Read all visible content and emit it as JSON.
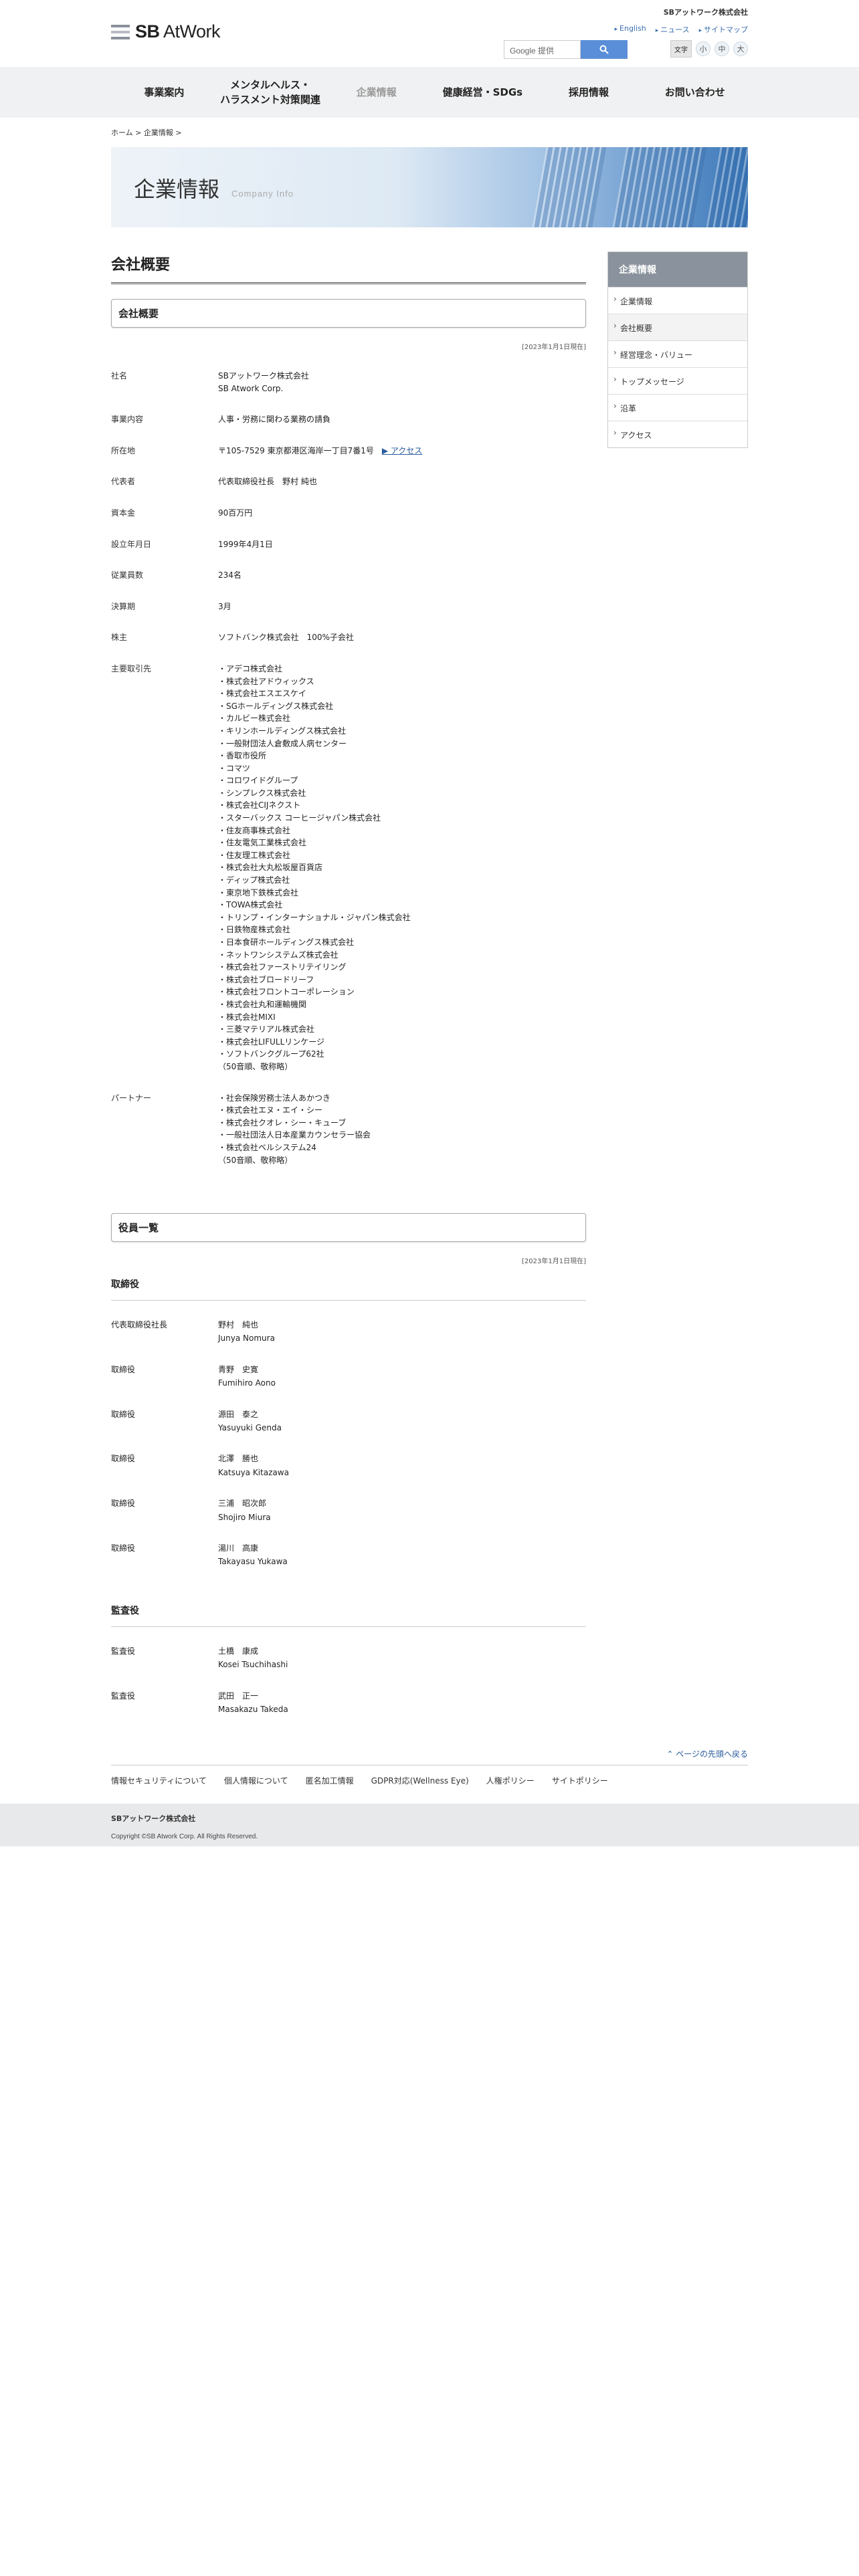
{
  "header": {
    "logo_text_prefix": "SB",
    "logo_text_main": "AtWork",
    "company_name": "SBアットワーク株式会社",
    "links": [
      "English",
      "ニュース",
      "サイトマップ"
    ],
    "search_placeholder": "Google 提供",
    "font_size_label": "文字",
    "font_sizes": [
      "小",
      "中",
      "大"
    ]
  },
  "nav": [
    {
      "line1": "事業案内",
      "line2": ""
    },
    {
      "line1": "メンタルヘルス・",
      "line2": "ハラスメント対策関連"
    },
    {
      "line1": "企業情報",
      "line2": ""
    },
    {
      "line1": "健康経営・SDGs",
      "line2": ""
    },
    {
      "line1": "採用情報",
      "line2": ""
    },
    {
      "line1": "お問い合わせ",
      "line2": ""
    }
  ],
  "breadcrumb": {
    "home": "ホーム",
    "current": "企業情報"
  },
  "hero": {
    "title": "企業情報",
    "subtitle": "Company Info"
  },
  "page_title": "会社概要",
  "overview": {
    "heading": "会社概要",
    "date": "[2023年1月1日現在]",
    "rows": [
      {
        "label": "社名",
        "lines": [
          "SBアットワーク株式会社",
          "SB Atwork Corp."
        ]
      },
      {
        "label": "事業内容",
        "lines": [
          "人事・労務に関わる業務の請負"
        ]
      },
      {
        "label": "所在地",
        "lines": [
          "〒105-7529 東京都港区海岸一丁目7番1号"
        ],
        "link": "▶ アクセス"
      },
      {
        "label": "代表者",
        "lines": [
          "代表取締役社長　野村 純也"
        ]
      },
      {
        "label": "資本金",
        "lines": [
          "90百万円"
        ]
      },
      {
        "label": "設立年月日",
        "lines": [
          "1999年4月1日"
        ]
      },
      {
        "label": "従業員数",
        "lines": [
          "234名"
        ]
      },
      {
        "label": "決算期",
        "lines": [
          "3月"
        ]
      },
      {
        "label": "株主",
        "lines": [
          "ソフトバンク株式会社　100%子会社"
        ]
      },
      {
        "label": "主要取引先",
        "lines": [
          "・アデコ株式会社",
          "・株式会社アドウィックス",
          "・株式会社エスエスケイ",
          "・SGホールディングス株式会社",
          "・カルビー株式会社",
          "・キリンホールディングス株式会社",
          "・一般財団法人倉敷成人病センター",
          "・香取市役所",
          "・コマツ",
          "・コロワイドグループ",
          "・シンプレクス株式会社",
          "・株式会社CIJネクスト",
          "・スターバックス コーヒージャパン株式会社",
          "・住友商事株式会社",
          "・住友電気工業株式会社",
          "・住友理工株式会社",
          "・株式会社大丸松坂屋百貨店",
          "・ディップ株式会社",
          "・東京地下鉄株式会社",
          "・TOWA株式会社",
          "・トリンプ・インターナショナル・ジャパン株式会社",
          "・日鉄物産株式会社",
          "・日本食研ホールディングス株式会社",
          "・ネットワンシステムズ株式会社",
          "・株式会社ファーストリテイリング",
          "・株式会社ブロードリーフ",
          "・株式会社フロントコーポレーション",
          "・株式会社丸和運輸機関",
          "・株式会社MIXI",
          "・三菱マテリアル株式会社",
          "・株式会社LIFULLリンケージ",
          "・ソフトバンクグループ62社",
          "（50音順、敬称略）"
        ]
      },
      {
        "label": "パートナー",
        "lines": [
          "・社会保険労務士法人あかつき",
          "・株式会社エヌ・エイ・シー",
          "・株式会社クオレ・シー・キューブ",
          "・一般社団法人日本産業カウンセラー協会",
          "・株式会社ベルシステム24",
          "（50音順、敬称略）"
        ]
      }
    ]
  },
  "officers": {
    "heading": "役員一覧",
    "date": "[2023年1月1日現在]",
    "directors_heading": "取締役",
    "directors": [
      {
        "title": "代表取締役社長",
        "name_jp": "野村　純也",
        "name_en": "Junya Nomura"
      },
      {
        "title": "取締役",
        "name_jp": "青野　史寛",
        "name_en": "Fumihiro Aono"
      },
      {
        "title": "取締役",
        "name_jp": "源田　泰之",
        "name_en": "Yasuyuki Genda"
      },
      {
        "title": "取締役",
        "name_jp": "北澤　勝也",
        "name_en": "Katsuya Kitazawa"
      },
      {
        "title": "取締役",
        "name_jp": "三浦　昭次郎",
        "name_en": "Shojiro Miura"
      },
      {
        "title": "取締役",
        "name_jp": "湯川　高康",
        "name_en": "Takayasu Yukawa"
      }
    ],
    "auditors_heading": "監査役",
    "auditors": [
      {
        "title": "監査役",
        "name_jp": "土橋　康成",
        "name_en": "Kosei Tsuchihashi"
      },
      {
        "title": "監査役",
        "name_jp": "武田　正一",
        "name_en": "Masakazu Takeda"
      }
    ]
  },
  "sidebar": {
    "heading": "企業情報",
    "items": [
      "企業情報",
      "会社概要",
      "経営理念・バリュー",
      "トップメッセージ",
      "沿革",
      "アクセス"
    ]
  },
  "pagetop": "ページの先頭へ戻る",
  "footer": {
    "links": [
      "情報セキュリティについて",
      "個人情報について",
      "匿名加工情報",
      "GDPR対応(Wellness Eye)",
      "人権ポリシー",
      "サイトポリシー"
    ],
    "company": "SBアットワーク株式会社",
    "copyright": "Copyright ©SB Atwork Corp. All Rights Reserved."
  }
}
